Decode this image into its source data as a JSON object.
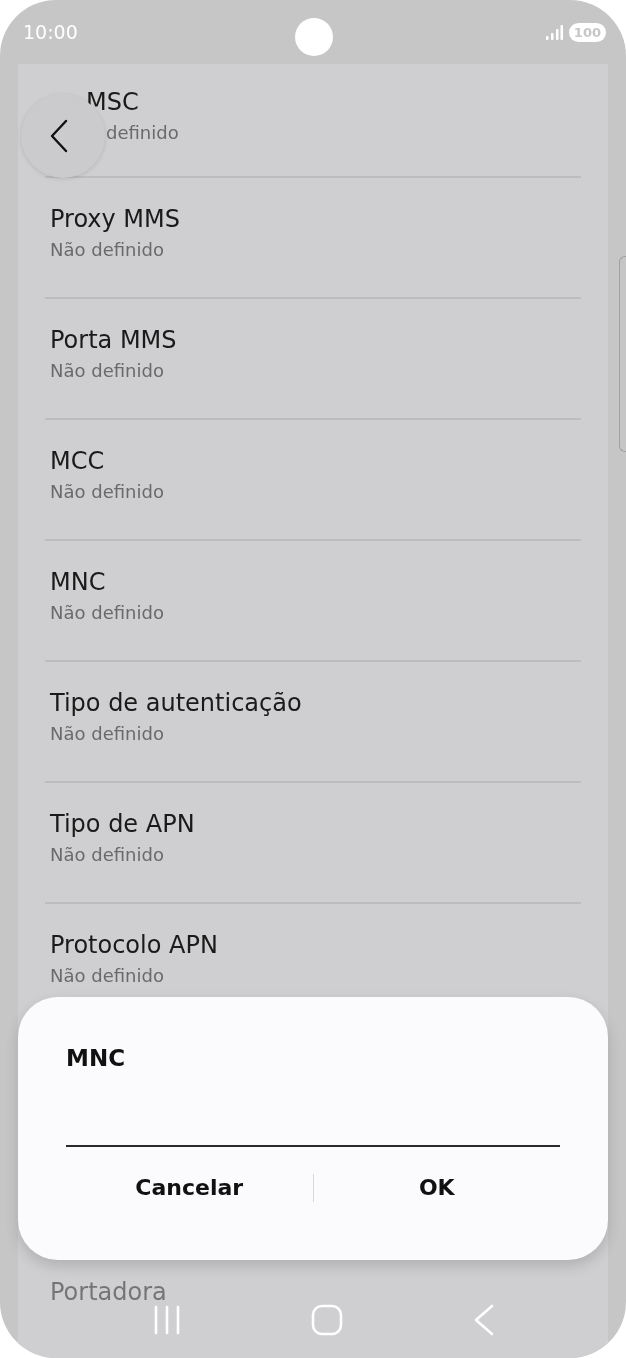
{
  "status_bar": {
    "time": "10:00",
    "battery": "100"
  },
  "top_setting": {
    "title": "MSC",
    "value": "definido"
  },
  "settings": [
    {
      "title": "Proxy MMS",
      "value": "Não definido"
    },
    {
      "title": "Porta MMS",
      "value": "Não definido"
    },
    {
      "title": "MCC",
      "value": "Não definido"
    },
    {
      "title": "MNC",
      "value": "Não definido"
    },
    {
      "title": "Tipo de autenticação",
      "value": "Não definido"
    },
    {
      "title": "Tipo de APN",
      "value": "Não definido"
    },
    {
      "title": "Protocolo APN",
      "value": "Não definido"
    }
  ],
  "bottom_setting": {
    "title": "Portadora"
  },
  "dialog": {
    "title": "MNC",
    "buttons": [
      "Cancelar",
      "OK"
    ]
  }
}
